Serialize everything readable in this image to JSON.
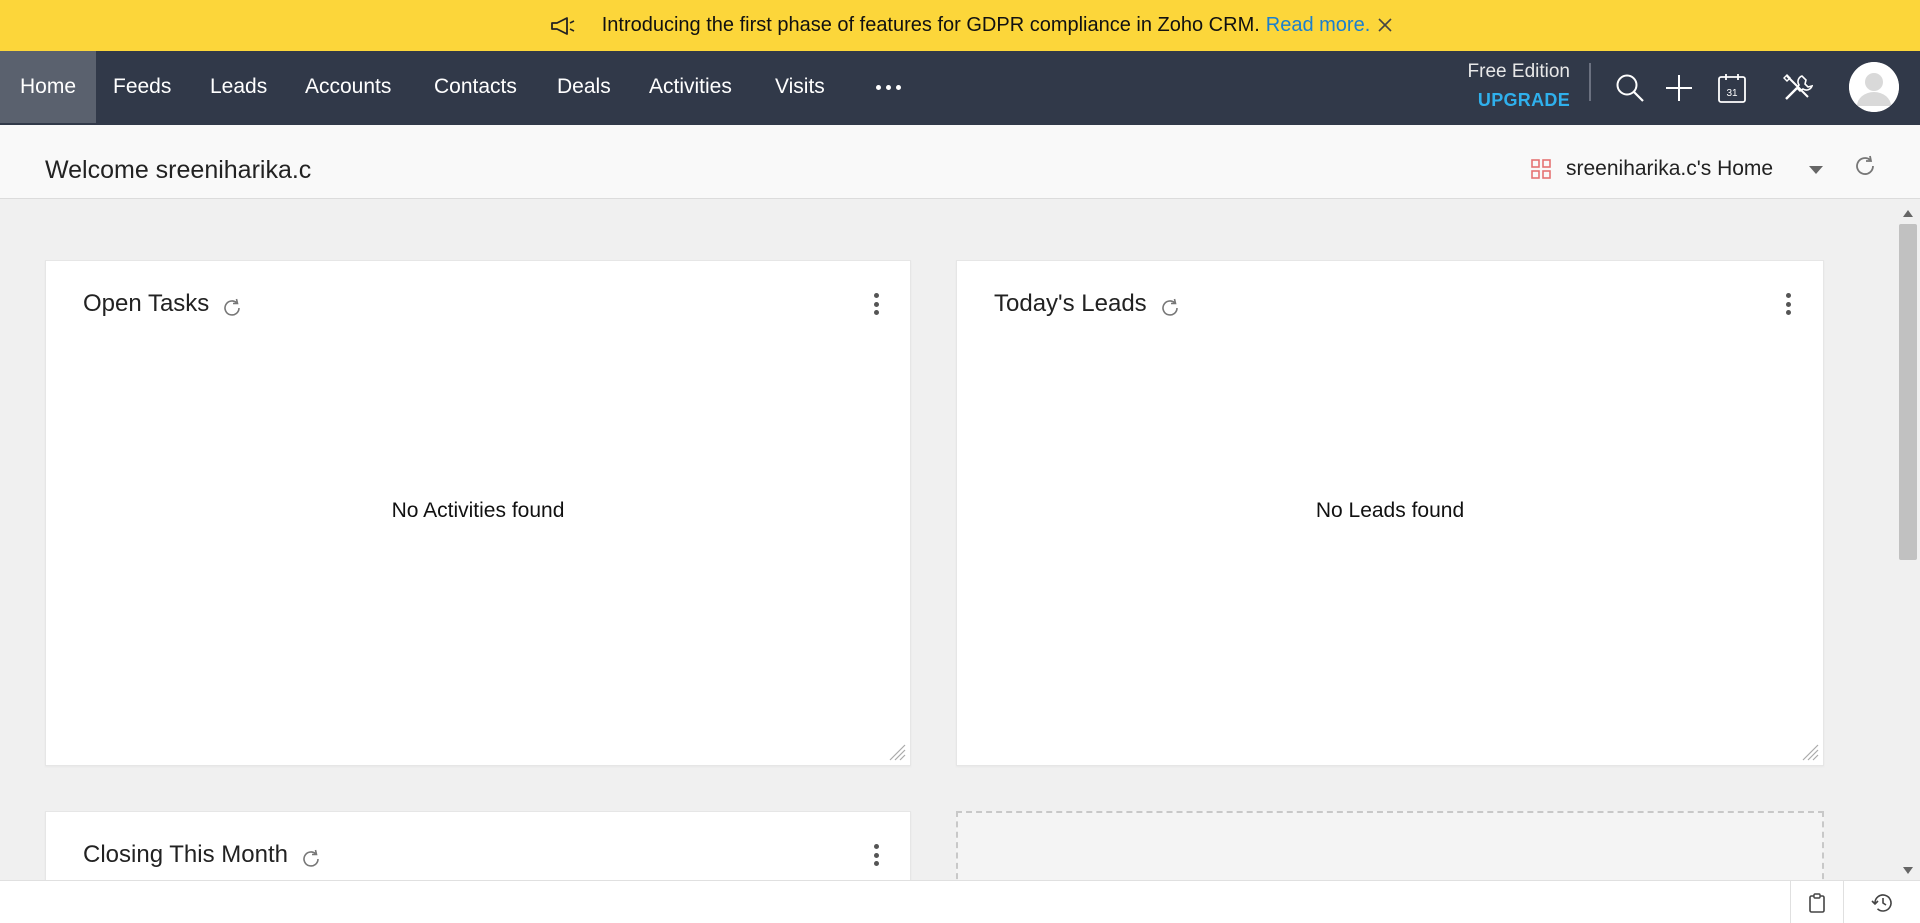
{
  "banner": {
    "message": "Introducing the first phase of features for GDPR compliance in Zoho CRM.",
    "link_text": "Read more.",
    "icon": "megaphone-icon",
    "close_icon": "close-icon"
  },
  "nav": {
    "tabs": [
      {
        "label": "Home",
        "active": true
      },
      {
        "label": "Feeds"
      },
      {
        "label": "Leads"
      },
      {
        "label": "Accounts"
      },
      {
        "label": "Contacts"
      },
      {
        "label": "Deals"
      },
      {
        "label": "Activities"
      },
      {
        "label": "Visits"
      }
    ],
    "more_icon": "more-horizontal-icon",
    "edition": "Free Edition",
    "upgrade": "UPGRADE",
    "icons": [
      "search-icon",
      "plus-icon",
      "calendar-icon",
      "setup-tools-icon",
      "avatar"
    ],
    "calendar_day": "31"
  },
  "header": {
    "welcome": "Welcome sreeniharika.c",
    "home_selector": "sreeniharika.c's Home"
  },
  "widgets": [
    {
      "title": "Open Tasks",
      "empty_text": "No Activities found"
    },
    {
      "title": "Today's Leads",
      "empty_text": "No Leads found"
    },
    {
      "title": "Closing This Month"
    }
  ],
  "colors": {
    "banner_bg": "#fcd63a",
    "nav_bg": "#313949",
    "nav_active": "#5a616e",
    "upgrade": "#2fb0ec",
    "link": "#1a7fcf"
  }
}
